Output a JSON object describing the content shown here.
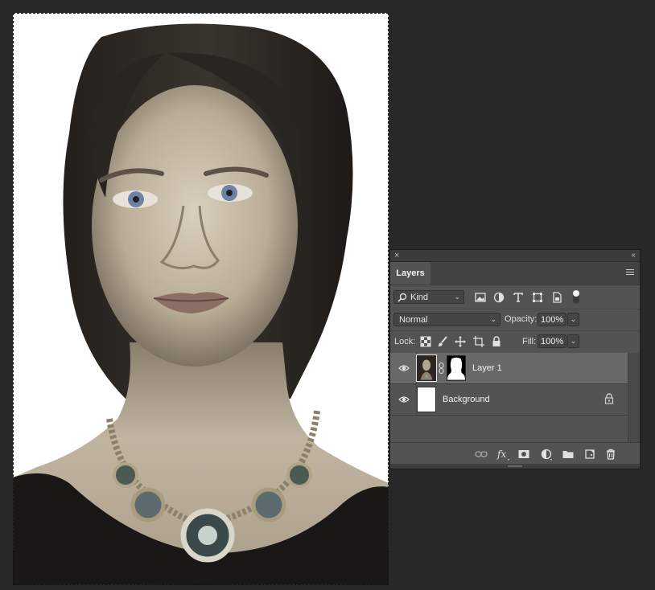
{
  "document": {
    "image_alt": "portrait-of-woman-with-necklace"
  },
  "panel": {
    "close_glyph": "×",
    "collapse_glyph": "‹‹",
    "tab_label": "Layers",
    "filter": {
      "kind_label": "Kind",
      "icons": [
        "image-filter-icon",
        "adjustment-filter-icon",
        "type-filter-icon",
        "shape-filter-icon",
        "smart-object-filter-icon"
      ]
    },
    "blend_mode": "Normal",
    "opacity_label": "Opacity:",
    "opacity_value": "100%",
    "lock_label": "Lock:",
    "fill_label": "Fill:",
    "fill_value": "100%",
    "layers": [
      {
        "name": "Layer 1",
        "visible": true,
        "selected": true,
        "has_mask": true
      },
      {
        "name": "Background",
        "visible": true,
        "selected": false,
        "locked": true
      }
    ],
    "bottom_icons": [
      "link-layers-icon",
      "fx-icon",
      "add-mask-icon",
      "adjustment-layer-icon",
      "new-group-icon",
      "new-layer-icon",
      "trash-icon"
    ]
  },
  "colors": {
    "app_background": "#282828",
    "panel_background": "#535353",
    "selected_row": "#696969"
  }
}
